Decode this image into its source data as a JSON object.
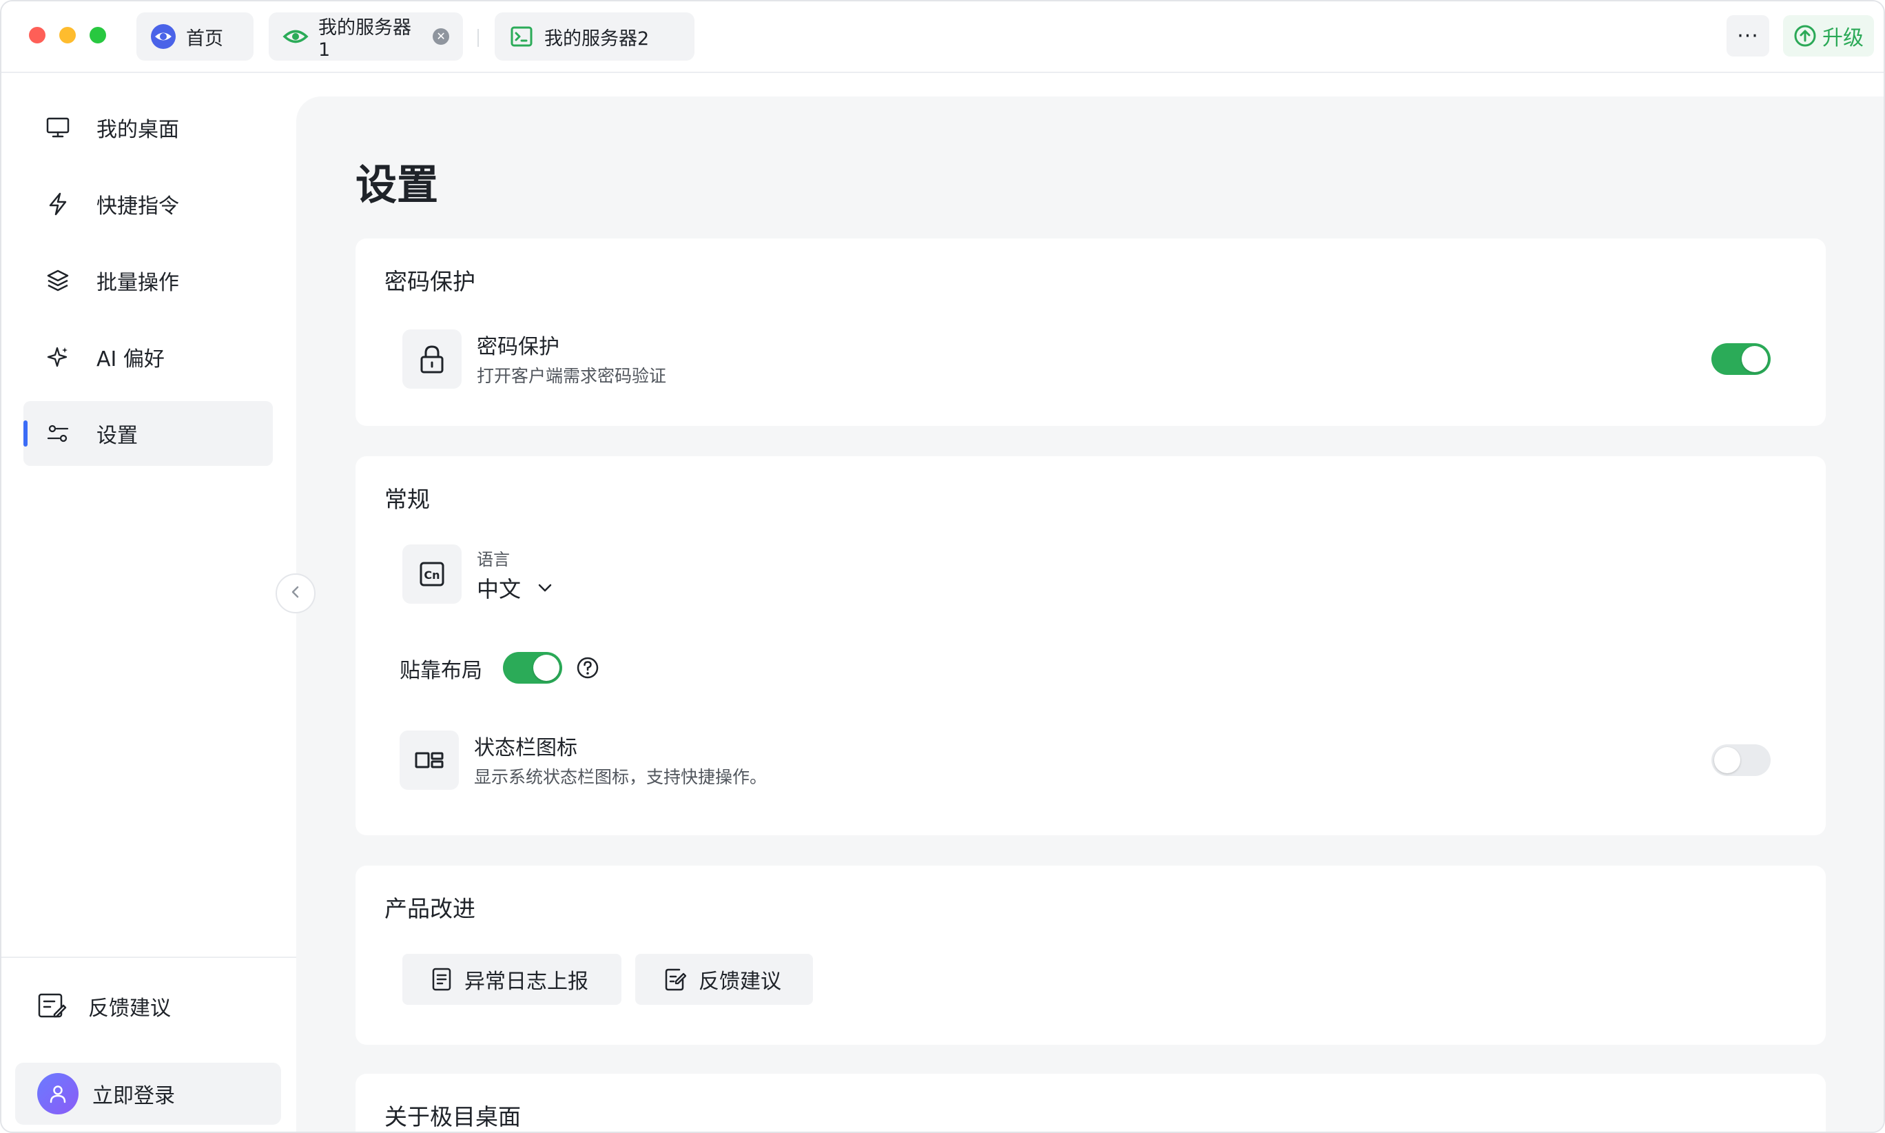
{
  "tabs": [
    {
      "label": "首页"
    },
    {
      "label": "我的服务器1"
    },
    {
      "label": "我的服务器2"
    }
  ],
  "titlebar": {
    "more_label": "···",
    "upgrade_label": "升级"
  },
  "sidebar": {
    "items": [
      {
        "label": "我的桌面",
        "icon": "monitor-icon"
      },
      {
        "label": "快捷指令",
        "icon": "lightning-icon"
      },
      {
        "label": "批量操作",
        "icon": "layers-icon"
      },
      {
        "label": "AI 偏好",
        "icon": "sparkle-icon"
      },
      {
        "label": "设置",
        "icon": "sliders-icon",
        "active": true
      }
    ],
    "feedback_label": "反馈建议",
    "login_label": "立即登录"
  },
  "main": {
    "title": "设置",
    "password_section": {
      "title": "密码保护",
      "row_title": "密码保护",
      "row_desc": "打开客户端需求密码验证",
      "enabled": true
    },
    "general_section": {
      "title": "常规",
      "language_label": "语言",
      "language_value": "中文",
      "snap_layout_label": "贴靠布局",
      "snap_layout_enabled": true,
      "statusbar_title": "状态栏图标",
      "statusbar_desc": "显示系统状态栏图标，支持快捷操作。",
      "statusbar_enabled": false
    },
    "product_section": {
      "title": "产品改进",
      "log_button": "异常日志上报",
      "feedback_button": "反馈建议"
    },
    "about_section": {
      "title": "关于极目桌面"
    }
  },
  "colors": {
    "accent_green": "#2bab58",
    "active_indicator": "#3b6cf6"
  }
}
